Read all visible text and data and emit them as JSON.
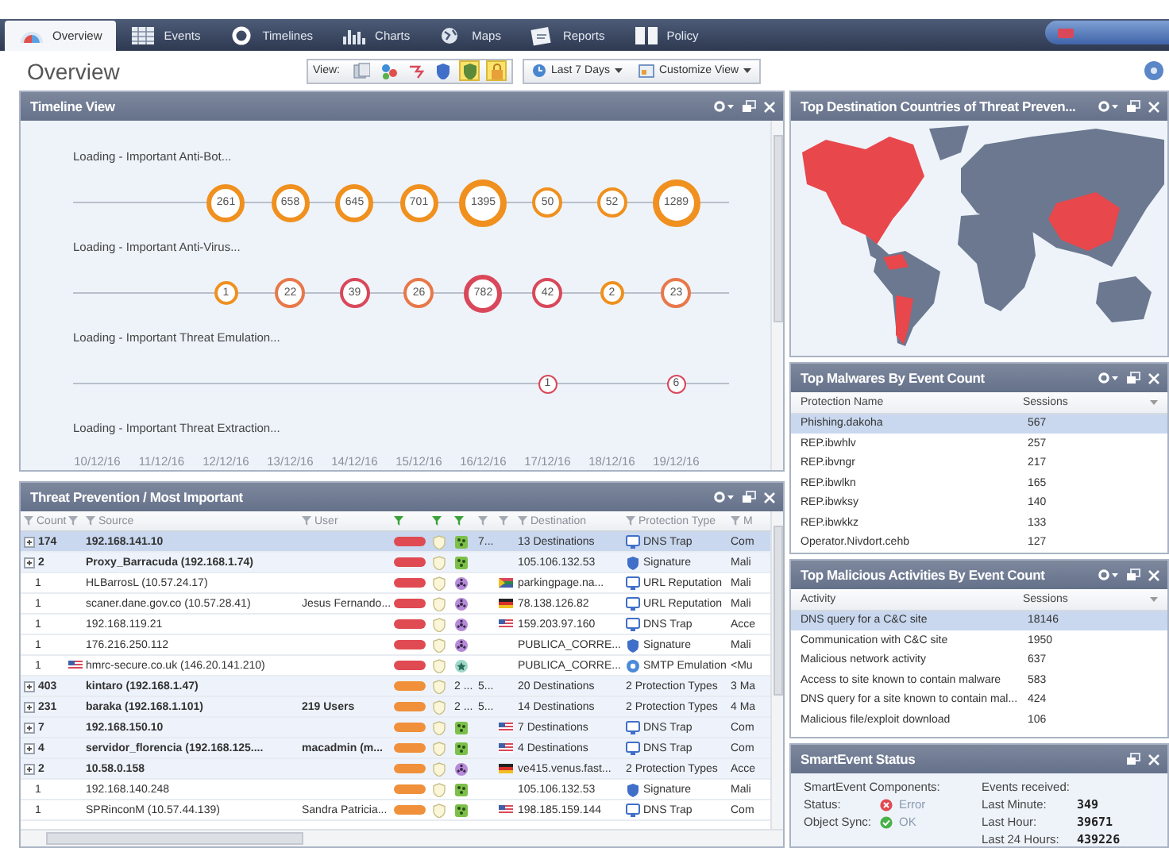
{
  "tabs": [
    {
      "label": "Overview",
      "selected": true
    },
    {
      "label": "Events",
      "selected": false
    },
    {
      "label": "Timelines",
      "selected": false
    },
    {
      "label": "Charts",
      "selected": false
    },
    {
      "label": "Maps",
      "selected": false
    },
    {
      "label": "Reports",
      "selected": false
    },
    {
      "label": "Policy",
      "selected": false
    }
  ],
  "page": {
    "title": "Overview"
  },
  "toolbar": {
    "view_label": "View:",
    "view_filters": [
      {
        "selected": false
      },
      {
        "selected": false
      },
      {
        "selected": false
      },
      {
        "selected": false
      },
      {
        "selected": true
      },
      {
        "selected": true
      }
    ],
    "time_range": "Last 7 Days",
    "customize": "Customize View"
  },
  "timeline": {
    "title": "Timeline View",
    "menu": true,
    "tracks": [
      {
        "label": "Loading - Important Anti-Bot..."
      },
      {
        "label": "Loading - Important Anti-Virus..."
      },
      {
        "label": "Loading - Important Threat Emulation..."
      },
      {
        "label": "Loading - Important Threat Extraction..."
      }
    ],
    "dates": [
      {
        "label": "10/12/16"
      },
      {
        "label": "11/12/16"
      },
      {
        "label": "12/12/16",
        "bubbles": [
          {
            "count": "261",
            "color": "#f0901e",
            "kind": "medium"
          },
          {
            "count": "1",
            "color": "#f0901e",
            "kind": "tiny"
          }
        ]
      },
      {
        "label": "13/12/16",
        "bubbles": [
          {
            "count": "658",
            "color": "#f0901e",
            "kind": "medium"
          },
          {
            "count": "22",
            "color": "#e8784a",
            "kind": "small"
          }
        ]
      },
      {
        "label": "14/12/16",
        "bubbles": [
          {
            "count": "645",
            "color": "#f0901e",
            "kind": "medium"
          },
          {
            "count": "39",
            "color": "#d9485a",
            "kind": "small"
          }
        ]
      },
      {
        "label": "15/12/16",
        "bubbles": [
          {
            "count": "701",
            "color": "#f0901e",
            "kind": "medium"
          },
          {
            "count": "26",
            "color": "#e8784a",
            "kind": "small"
          }
        ]
      },
      {
        "label": "16/12/16",
        "bubbles": [
          {
            "count": "1395",
            "color": "#f0901e",
            "kind": "large"
          },
          {
            "count": "782",
            "color": "#d9485a",
            "kind": "medium"
          }
        ]
      },
      {
        "label": "17/12/16",
        "bubbles": [
          {
            "count": "50",
            "color": "#f0901e",
            "kind": "small"
          },
          {
            "count": "42",
            "color": "#d9485a",
            "kind": "small"
          },
          {
            "count": "1",
            "color": "#d9485a",
            "kind": "mini"
          }
        ]
      },
      {
        "label": "18/12/16",
        "bubbles": [
          {
            "count": "52",
            "color": "#f0901e",
            "kind": "small"
          },
          {
            "count": "2",
            "color": "#f0901e",
            "kind": "tiny"
          }
        ]
      },
      {
        "label": "19/12/16",
        "bubbles": [
          {
            "count": "1289",
            "color": "#f0901e",
            "kind": "large"
          },
          {
            "count": "23",
            "color": "#e8784a",
            "kind": "small"
          },
          {
            "count": "6",
            "color": "#d9485a",
            "kind": "mini"
          }
        ]
      }
    ]
  },
  "threats": {
    "title": "Threat Prevention / Most Important",
    "menu": true,
    "columns": [
      {
        "label": "Count",
        "filtered": false
      },
      {
        "filtered": false
      },
      {
        "label": "Source",
        "filtered": false
      },
      {
        "label": "User",
        "filtered": false
      },
      {
        "filtered": true
      },
      {
        "filtered": true
      },
      {
        "filtered": true
      },
      {
        "filtered": false
      },
      {
        "filtered": false
      },
      {
        "label": "Destination",
        "filtered": false
      },
      {
        "label": "Protection Type",
        "filtered": false
      },
      {
        "label": "M",
        "filtered": false
      }
    ],
    "rows": [
      {
        "expandable": true,
        "selected": true,
        "count": "174",
        "source": "192.168.141.10",
        "severity": {
          "kind": "critical"
        },
        "blade": {
          "kind": "bot"
        },
        "column_9": "7...",
        "destination": "13 Destinations",
        "protection": {
          "kind": "dns",
          "label": "DNS Trap"
        },
        "column_12": "Com"
      },
      {
        "expandable": true,
        "selected": false,
        "count": "2",
        "source": "Proxy_Barracuda (192.168.1.74)",
        "severity": {
          "kind": "critical"
        },
        "blade": {
          "kind": "bot"
        },
        "destination": "105.106.132.53",
        "protection": {
          "kind": "signature",
          "label": "Signature"
        },
        "column_12": "Mali"
      },
      {
        "expandable": false,
        "selected": false,
        "count": "1",
        "source": "HLBarrosL (10.57.24.17)",
        "severity": {
          "kind": "critical"
        },
        "blade": {
          "kind": "virus"
        },
        "dest_flag": {
          "kind": "za"
        },
        "destination": "parkingpage.na...",
        "protection": {
          "kind": "dns",
          "label": "URL Reputation"
        },
        "column_12": "Mali"
      },
      {
        "expandable": false,
        "selected": false,
        "count": "1",
        "source": "scaner.dane.gov.co (10.57.28.41)",
        "user": "Jesus Fernando...",
        "severity": {
          "kind": "critical"
        },
        "blade": {
          "kind": "virus"
        },
        "dest_flag": {
          "kind": "de"
        },
        "destination": "78.138.126.82",
        "protection": {
          "kind": "dns",
          "label": "URL Reputation"
        },
        "column_12": "Mali"
      },
      {
        "expandable": false,
        "selected": false,
        "count": "1",
        "source": "192.168.119.21",
        "severity": {
          "kind": "critical"
        },
        "blade": {
          "kind": "virus"
        },
        "dest_flag": {
          "kind": "us"
        },
        "destination": "159.203.97.160",
        "protection": {
          "kind": "dns",
          "label": "DNS Trap"
        },
        "column_12": "Acce"
      },
      {
        "expandable": false,
        "selected": false,
        "count": "1",
        "source": "176.216.250.112",
        "severity": {
          "kind": "critical"
        },
        "blade": {
          "kind": "virus"
        },
        "destination": "PUBLICA_CORRE...",
        "protection": {
          "kind": "signature",
          "label": "Signature"
        },
        "column_12": "Mali"
      },
      {
        "expandable": false,
        "selected": false,
        "count": "1",
        "source_flag": {
          "kind": "us"
        },
        "source": "hmrc-secure.co.uk (146.20.141.210)",
        "severity": {
          "kind": "critical"
        },
        "blade": {
          "kind": "emulation"
        },
        "destination": "PUBLICA_CORRE...",
        "protection": {
          "kind": "smtp",
          "label": "SMTP Emulation"
        },
        "column_12": "<Mu"
      },
      {
        "expandable": true,
        "selected": false,
        "count": "403",
        "source": "kintaro (192.168.1.47)",
        "severity": {
          "kind": "high"
        },
        "blade": {
          "kind": "multiple",
          "label": "2 ..."
        },
        "column_9": "5...",
        "destination": "20 Destinations",
        "protection": {
          "kind": "multiple",
          "label": "2 Protection Types"
        },
        "column_12": "3 Ma"
      },
      {
        "expandable": true,
        "selected": false,
        "count": "231",
        "source": "baraka (192.168.1.101)",
        "user": "219 Users",
        "severity": {
          "kind": "high"
        },
        "blade": {
          "kind": "multiple",
          "label": "2 ..."
        },
        "column_9": "5...",
        "destination": "14 Destinations",
        "protection": {
          "kind": "multiple",
          "label": "2 Protection Types"
        },
        "column_12": "4 Ma"
      },
      {
        "expandable": true,
        "selected": false,
        "count": "7",
        "source": "192.168.150.10",
        "severity": {
          "kind": "high"
        },
        "blade": {
          "kind": "bot"
        },
        "dest_flag": {
          "kind": "us"
        },
        "destination": "7 Destinations",
        "protection": {
          "kind": "dns",
          "label": "DNS Trap"
        },
        "column_12": "Com"
      },
      {
        "expandable": true,
        "selected": false,
        "count": "4",
        "source": "servidor_florencia (192.168.125....",
        "user": "macadmin (m...",
        "severity": {
          "kind": "high"
        },
        "blade": {
          "kind": "bot"
        },
        "dest_flag": {
          "kind": "us"
        },
        "destination": "4 Destinations",
        "protection": {
          "kind": "dns",
          "label": "DNS Trap"
        },
        "column_12": "Com"
      },
      {
        "expandable": true,
        "selected": false,
        "count": "2",
        "source": "10.58.0.158",
        "severity": {
          "kind": "high"
        },
        "blade": {
          "kind": "virus"
        },
        "dest_flag": {
          "kind": "de"
        },
        "destination": "ve415.venus.fast...",
        "protection": {
          "kind": "multiple",
          "label": "2 Protection Types"
        },
        "column_12": "Acce"
      },
      {
        "expandable": false,
        "selected": false,
        "count": "1",
        "source": "192.168.140.248",
        "severity": {
          "kind": "high"
        },
        "blade": {
          "kind": "bot"
        },
        "destination": "105.106.132.53",
        "protection": {
          "kind": "signature",
          "label": "Signature"
        },
        "column_12": "Mali"
      },
      {
        "expandable": false,
        "selected": false,
        "count": "1",
        "source": "SPRinconM (10.57.44.139)",
        "user": "Sandra Patricia...",
        "severity": {
          "kind": "high"
        },
        "blade": {
          "kind": "bot"
        },
        "dest_flag": {
          "kind": "us"
        },
        "destination": "198.185.159.144",
        "protection": {
          "kind": "dns",
          "label": "DNS Trap"
        },
        "column_12": "Com"
      }
    ]
  },
  "countries": {
    "title": "Top Destination Countries of Threat Preven...",
    "menu": true
  },
  "malwares": {
    "title": "Top Malwares By Event Count",
    "menu": true,
    "columns": [
      "Protection Name",
      "Sessions"
    ],
    "rows": [
      {
        "name": "Phishing.dakoha",
        "sessions": "567",
        "selected": true
      },
      {
        "name": "REP.ibwhlv",
        "sessions": "257",
        "selected": false
      },
      {
        "name": "REP.ibvngr",
        "sessions": "217",
        "selected": false
      },
      {
        "name": "REP.ibwlkn",
        "sessions": "165",
        "selected": false
      },
      {
        "name": "REP.ibwksy",
        "sessions": "140",
        "selected": false
      },
      {
        "name": "REP.ibwkkz",
        "sessions": "133",
        "selected": false
      },
      {
        "name": "Operator.Nivdort.cehb",
        "sessions": "127",
        "selected": false
      }
    ]
  },
  "activities": {
    "title": "Top Malicious Activities By Event Count",
    "menu": true,
    "columns": [
      "Activity",
      "Sessions"
    ],
    "rows": [
      {
        "name": "DNS query for a C&C site",
        "sessions": "18146",
        "selected": true
      },
      {
        "name": "Communication with C&C site",
        "sessions": "1950",
        "selected": false
      },
      {
        "name": "Malicious network activity",
        "sessions": "637",
        "selected": false
      },
      {
        "name": "Access to site known to contain malware",
        "sessions": "583",
        "selected": false
      },
      {
        "name": "DNS query for a site known to contain mal...",
        "sessions": "424",
        "selected": false
      },
      {
        "name": "Malicious file/exploit download",
        "sessions": "106",
        "selected": false
      }
    ]
  },
  "status": {
    "title": "SmartEvent Status",
    "menu": false,
    "components_label": "SmartEvent Components:",
    "items": [
      {
        "label": "Status:",
        "kind": "error",
        "value": "Error"
      },
      {
        "label": "Object Sync:",
        "kind": "ok",
        "value": "OK"
      }
    ],
    "events_label": "Events received:",
    "events": [
      {
        "label": "Last Minute:",
        "value": "349"
      },
      {
        "label": "Last Hour:",
        "value": "39671"
      },
      {
        "label": "Last 24 Hours:",
        "value": "439226"
      }
    ]
  }
}
